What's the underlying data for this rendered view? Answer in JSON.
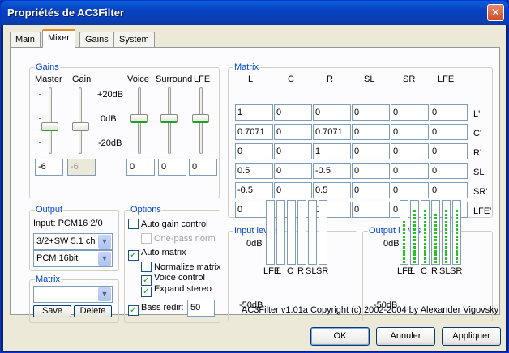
{
  "window": {
    "title": "Propriétés de AC3Filter",
    "close_glyph": "✕"
  },
  "tabs": [
    {
      "label": "Main"
    },
    {
      "label": "Mixer"
    },
    {
      "label": "Gains"
    },
    {
      "label": "System"
    }
  ],
  "gains": {
    "label": "Gains",
    "col_labels": {
      "master": "Master",
      "gain": "Gain",
      "voice": "Voice",
      "surround": "Surround",
      "lfe": "LFE"
    },
    "scale": {
      "top": "+20dB",
      "mid": "0dB",
      "bottom": "-20dB"
    },
    "values": {
      "master": "-6",
      "gain": "-6",
      "voice": "0",
      "surround": "0",
      "lfe": "0"
    }
  },
  "matrix": {
    "label": "Matrix",
    "col_headers": [
      "L",
      "C",
      "R",
      "SL",
      "SR",
      "LFE"
    ],
    "row_headers": [
      "L'",
      "C'",
      "R'",
      "SL'",
      "SR'",
      "LFE'"
    ],
    "rows": [
      [
        "1",
        "0",
        "0",
        "0",
        "0",
        "0"
      ],
      [
        "0.7071",
        "0",
        "0.7071",
        "0",
        "0",
        "0"
      ],
      [
        "0",
        "0",
        "1",
        "0",
        "0",
        "0"
      ],
      [
        "0.5",
        "0",
        "-0.5",
        "0",
        "0",
        "0"
      ],
      [
        "-0.5",
        "0",
        "0.5",
        "0",
        "0",
        "0"
      ],
      [
        "0",
        "0",
        "0",
        "0",
        "0",
        "0"
      ]
    ]
  },
  "output": {
    "label": "Output",
    "input_text": "Input: PCM16 2/0",
    "speakers": "3/2+SW 5.1 ch",
    "format": "PCM 16bit"
  },
  "matrix_preset": {
    "label": "Matrix",
    "value": "",
    "save_label": "Save",
    "delete_label": "Delete"
  },
  "options": {
    "label": "Options",
    "auto_gain": {
      "label": "Auto gain control",
      "checked": false
    },
    "one_pass": {
      "label": "One-pass norm",
      "checked": false
    },
    "auto_matrix": {
      "label": "Auto matrix",
      "checked": true
    },
    "normalize": {
      "label": "Normalize matrix",
      "checked": false
    },
    "voice_control": {
      "label": "Voice control",
      "checked": true
    },
    "expand_stereo": {
      "label": "Expand stereo",
      "checked": true
    },
    "bass_redir": {
      "label": "Bass redir:",
      "checked": true,
      "value": "50"
    }
  },
  "input_levels": {
    "label": "Input levels",
    "top": "0dB",
    "bottom": "-50dB",
    "channels": [
      "LFE",
      "L",
      "C",
      "R",
      "SL",
      "SR"
    ],
    "levels": [
      0,
      0,
      0,
      0,
      0,
      0
    ]
  },
  "output_levels": {
    "label": "Output levels",
    "top": "0dB",
    "bottom": "-50dB",
    "channels": [
      "LFE",
      "L",
      "C",
      "R",
      "SL",
      "SR"
    ],
    "levels": [
      0.75,
      0.95,
      0.95,
      0.85,
      0.95,
      0.95
    ]
  },
  "copyright": "AC3Filter v1.01a Copyright (c) 2002-2004 by Alexander Vigovsky",
  "buttons": {
    "ok": "OK",
    "cancel": "Annuler",
    "apply": "Appliquer"
  }
}
